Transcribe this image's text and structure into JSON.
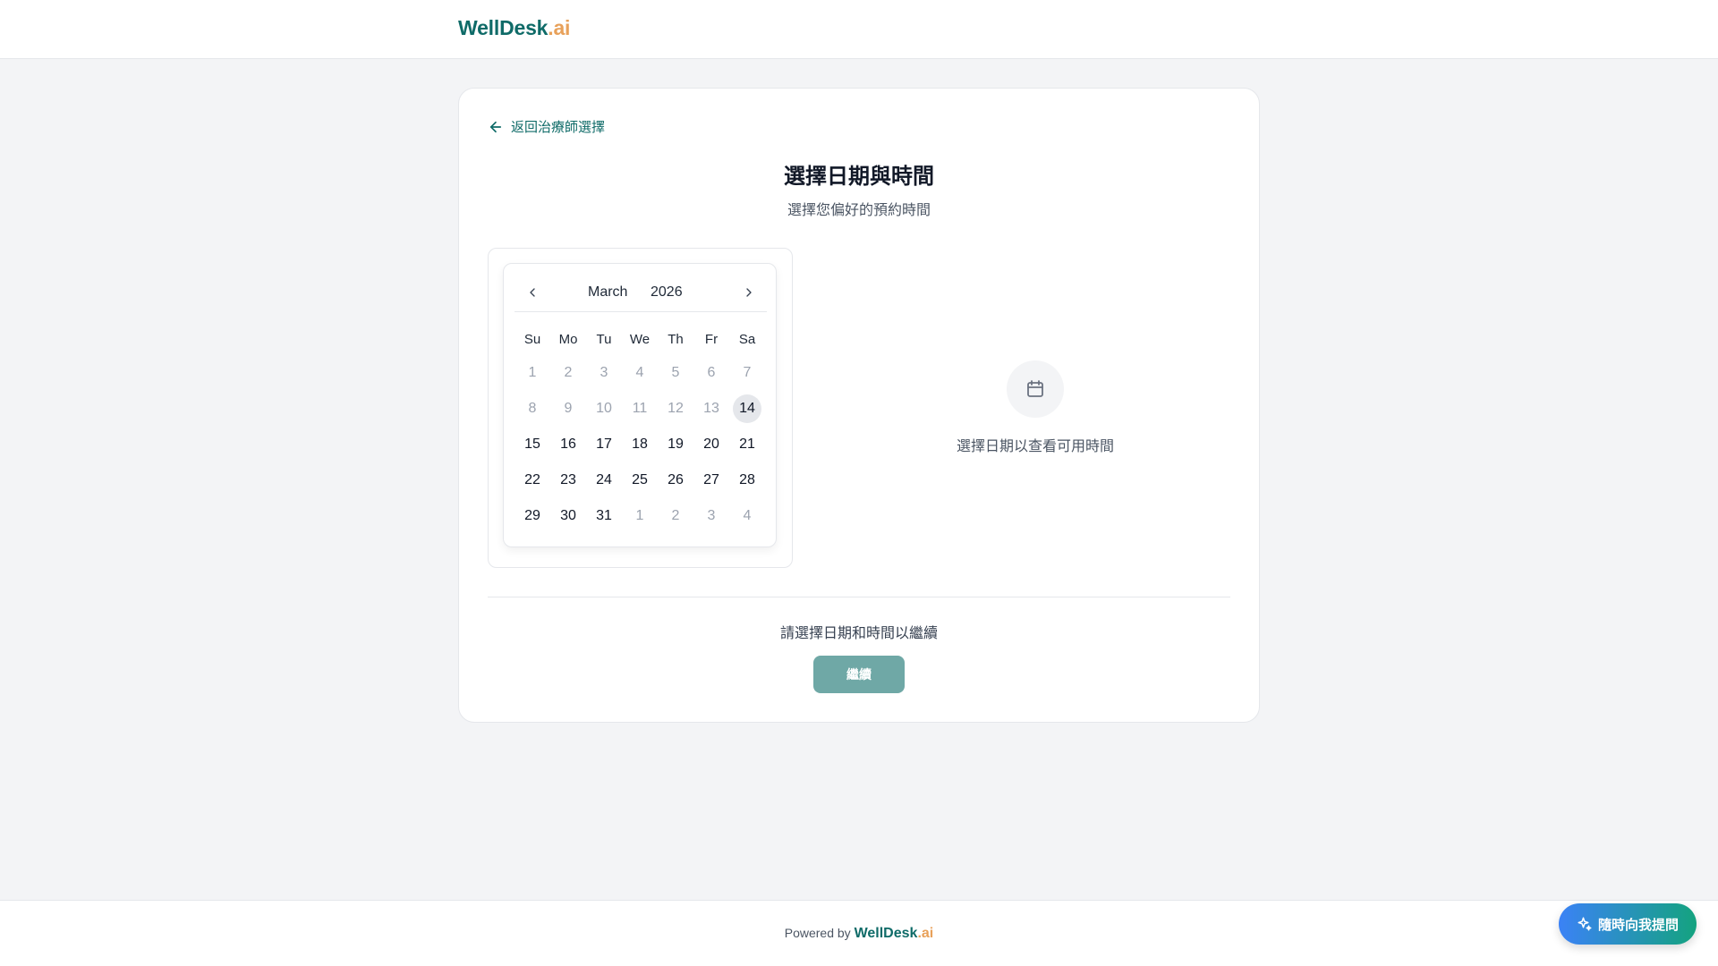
{
  "header": {
    "logo_main": "WellDesk",
    "logo_suffix": ".ai"
  },
  "card": {
    "back_label": "返回治療師選擇",
    "title": "選擇日期與時間",
    "subtitle": "選擇您偏好的預約時間"
  },
  "calendar": {
    "month": "March",
    "year": "2026",
    "weekdays": [
      "Su",
      "Mo",
      "Tu",
      "We",
      "Th",
      "Fr",
      "Sa"
    ],
    "days": [
      {
        "label": "1",
        "state": "disabled"
      },
      {
        "label": "2",
        "state": "disabled"
      },
      {
        "label": "3",
        "state": "disabled"
      },
      {
        "label": "4",
        "state": "disabled"
      },
      {
        "label": "5",
        "state": "disabled"
      },
      {
        "label": "6",
        "state": "disabled"
      },
      {
        "label": "7",
        "state": "disabled"
      },
      {
        "label": "8",
        "state": "disabled"
      },
      {
        "label": "9",
        "state": "disabled"
      },
      {
        "label": "10",
        "state": "disabled"
      },
      {
        "label": "11",
        "state": "disabled"
      },
      {
        "label": "12",
        "state": "disabled"
      },
      {
        "label": "13",
        "state": "disabled"
      },
      {
        "label": "14",
        "state": "today"
      },
      {
        "label": "15",
        "state": "available"
      },
      {
        "label": "16",
        "state": "available"
      },
      {
        "label": "17",
        "state": "available"
      },
      {
        "label": "18",
        "state": "available"
      },
      {
        "label": "19",
        "state": "available"
      },
      {
        "label": "20",
        "state": "available"
      },
      {
        "label": "21",
        "state": "available"
      },
      {
        "label": "22",
        "state": "available"
      },
      {
        "label": "23",
        "state": "available"
      },
      {
        "label": "24",
        "state": "available"
      },
      {
        "label": "25",
        "state": "available"
      },
      {
        "label": "26",
        "state": "available"
      },
      {
        "label": "27",
        "state": "available"
      },
      {
        "label": "28",
        "state": "available"
      },
      {
        "label": "29",
        "state": "available"
      },
      {
        "label": "30",
        "state": "available"
      },
      {
        "label": "31",
        "state": "available"
      },
      {
        "label": "1",
        "state": "outside"
      },
      {
        "label": "2",
        "state": "outside"
      },
      {
        "label": "3",
        "state": "outside"
      },
      {
        "label": "4",
        "state": "outside"
      }
    ]
  },
  "time_panel": {
    "icon": "calendar-icon",
    "empty_message": "選擇日期以查看可用時間"
  },
  "actions": {
    "hint": "請選擇日期和時間以繼續",
    "continue_label": "繼續"
  },
  "footer": {
    "powered_by": "Powered by",
    "brand_main": "WellDesk",
    "brand_suffix": ".ai"
  },
  "assistant": {
    "icon": "sparkle-icon",
    "label": "隨時向我提問"
  },
  "colors": {
    "brand": "#0f6b68",
    "accent": "#e8a15a",
    "button_disabled": "#6fa8a6"
  }
}
